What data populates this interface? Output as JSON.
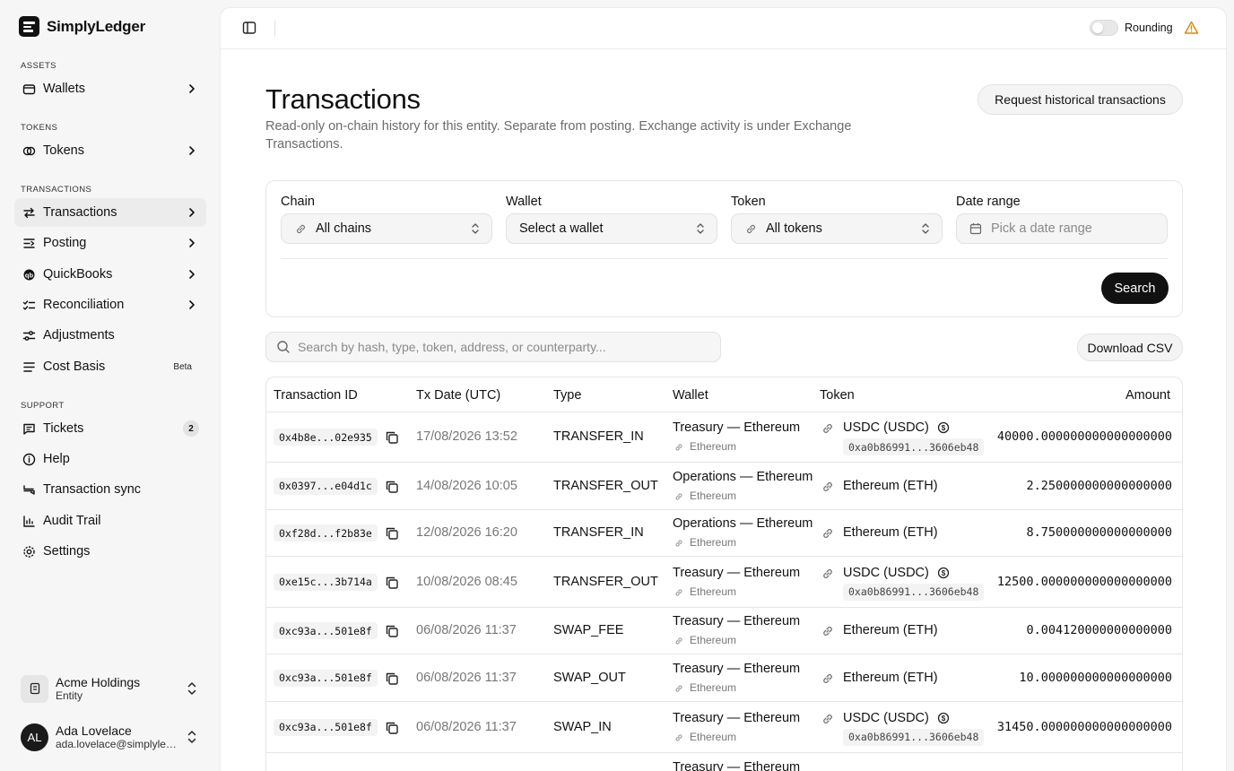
{
  "app": {
    "name": "SimplyLedger"
  },
  "sidebar": {
    "sections": {
      "assets": "ASSETS",
      "tokens": "TOKENS",
      "transactions": "TRANSACTIONS",
      "support": "SUPPORT"
    },
    "items": [
      {
        "label": "Wallets",
        "icon": "wallet-icon"
      },
      {
        "label": "Tokens",
        "icon": "coins-icon"
      },
      {
        "label": "Transactions",
        "icon": "arrows-left-right-icon",
        "active": true
      },
      {
        "label": "Posting",
        "icon": "posting-icon"
      },
      {
        "label": "QuickBooks",
        "icon": "quickbooks-icon"
      },
      {
        "label": "Reconciliation",
        "icon": "list-check-icon"
      },
      {
        "label": "Adjustments",
        "icon": "sliders-icon"
      },
      {
        "label": "Cost Basis",
        "icon": "layers-icon",
        "badge": "Beta"
      },
      {
        "label": "Tickets",
        "icon": "message-icon",
        "count": "2"
      },
      {
        "label": "Help",
        "icon": "info-icon"
      },
      {
        "label": "Transaction sync",
        "icon": "sync-icon"
      },
      {
        "label": "Audit Trail",
        "icon": "audit-icon"
      },
      {
        "label": "Settings",
        "icon": "gear-icon"
      }
    ],
    "entity": {
      "name": "Acme Holdings",
      "type": "Entity"
    },
    "user": {
      "initials": "AL",
      "name": "Ada Lovelace",
      "email": "ada.lovelace@simplyledger.io"
    }
  },
  "topbar": {
    "rounding_label": "Rounding",
    "rounding_on": false
  },
  "page": {
    "title": "Transactions",
    "description": "Read-only on-chain history for this entity. Separate from posting. Exchange activity is under Exchange Transactions.",
    "request_button": "Request historical transactions"
  },
  "filters": {
    "chain": {
      "label": "Chain",
      "value": "All chains"
    },
    "wallet": {
      "label": "Wallet",
      "value": "Select a wallet"
    },
    "token": {
      "label": "Token",
      "value": "All tokens"
    },
    "date": {
      "label": "Date range",
      "placeholder": "Pick a date range"
    },
    "search_button": "Search"
  },
  "search": {
    "placeholder": "Search by hash, type, token, address, or counterparty..."
  },
  "download_button": "Download CSV",
  "table": {
    "headers": {
      "id": "Transaction ID",
      "date": "Tx Date (UTC)",
      "type": "Type",
      "wallet": "Wallet",
      "token": "Token",
      "amount": "Amount"
    },
    "rows": [
      {
        "id": "0x4b8e...02e935",
        "date": "17/08/2026 13:52",
        "type": "TRANSFER_IN",
        "wallet": "Treasury — Ethereum",
        "chain": "Ethereum",
        "token": "USDC (USDC)",
        "token_addr": "0xa0b86991...3606eb48",
        "amount": "40000.000000000000000000"
      },
      {
        "id": "0x0397...e04d1c",
        "date": "14/08/2026 10:05",
        "type": "TRANSFER_OUT",
        "wallet": "Operations — Ethereum",
        "chain": "Ethereum",
        "token": "Ethereum (ETH)",
        "token_addr": "",
        "amount": "2.250000000000000000"
      },
      {
        "id": "0xf28d...f2b83e",
        "date": "12/08/2026 16:20",
        "type": "TRANSFER_IN",
        "wallet": "Operations — Ethereum",
        "chain": "Ethereum",
        "token": "Ethereum (ETH)",
        "token_addr": "",
        "amount": "8.750000000000000000"
      },
      {
        "id": "0xe15c...3b714a",
        "date": "10/08/2026 08:45",
        "type": "TRANSFER_OUT",
        "wallet": "Treasury — Ethereum",
        "chain": "Ethereum",
        "token": "USDC (USDC)",
        "token_addr": "0xa0b86991...3606eb48",
        "amount": "12500.000000000000000000"
      },
      {
        "id": "0xc93a...501e8f",
        "date": "06/08/2026 11:37",
        "type": "SWAP_FEE",
        "wallet": "Treasury — Ethereum",
        "chain": "Ethereum",
        "token": "Ethereum (ETH)",
        "token_addr": "",
        "amount": "0.004120000000000000"
      },
      {
        "id": "0xc93a...501e8f",
        "date": "06/08/2026 11:37",
        "type": "SWAP_OUT",
        "wallet": "Treasury — Ethereum",
        "chain": "Ethereum",
        "token": "Ethereum (ETH)",
        "token_addr": "",
        "amount": "10.000000000000000000"
      },
      {
        "id": "0xc93a...501e8f",
        "date": "06/08/2026 11:37",
        "type": "SWAP_IN",
        "wallet": "Treasury — Ethereum",
        "chain": "Ethereum",
        "token": "USDC (USDC)",
        "token_addr": "0xa0b86991...3606eb48",
        "amount": "31450.000000000000000000"
      },
      {
        "id": "",
        "date": "",
        "type": "",
        "wallet": "Treasury — Ethereum",
        "chain": "",
        "token": "",
        "token_addr": "",
        "amount": ""
      }
    ]
  }
}
